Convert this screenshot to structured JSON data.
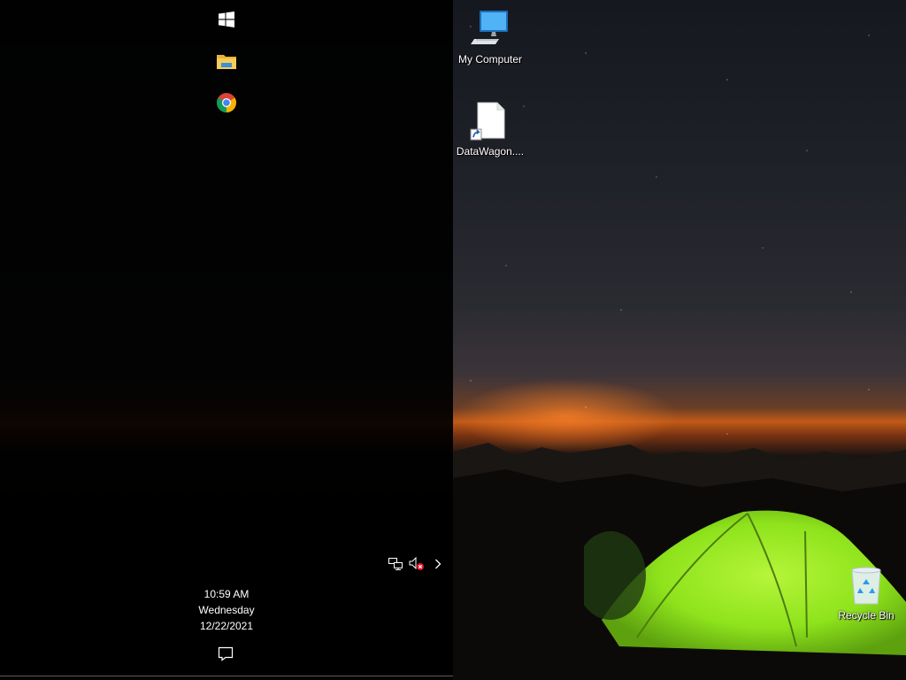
{
  "taskbar": {
    "pinned": [
      {
        "name": "Start",
        "icon": "windows-logo-icon"
      },
      {
        "name": "File Explorer",
        "icon": "folder-icon"
      },
      {
        "name": "Google Chrome",
        "icon": "chrome-icon"
      }
    ],
    "tray": {
      "icons": [
        "network-icon",
        "volume-muted-icon",
        "chevron-right-icon"
      ],
      "time": "10:59 AM",
      "day": "Wednesday",
      "date": "12/22/2021",
      "action_center_icon": "notification-icon"
    }
  },
  "desktop": {
    "icons": [
      {
        "label": "My Computer",
        "icon": "computer-icon"
      },
      {
        "label": "DataWagon....",
        "icon": "file-shortcut-icon"
      },
      {
        "label": "Recycle Bin",
        "icon": "recycle-bin-icon"
      }
    ]
  },
  "colors": {
    "accent": "#2b9af3",
    "tent": "#8ee31c",
    "horizon": "#c05a17"
  }
}
